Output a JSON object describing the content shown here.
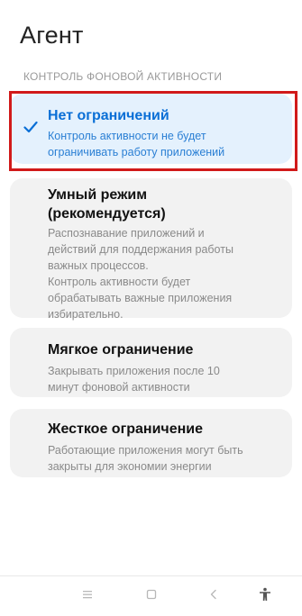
{
  "header": {
    "title": "Агент"
  },
  "section": {
    "label": "КОНТРОЛЬ ФОНОВОЙ АКТИВНОСТИ"
  },
  "options": [
    {
      "title": "Нет ограничений",
      "desc_lines": [
        "Контроль активности не будет",
        "ограничивать работу приложений"
      ],
      "selected": true
    },
    {
      "title_lines": [
        "Умный режим",
        "(рекомендуется)"
      ],
      "desc_lines": [
        "Распознавание приложений и",
        "действий для поддержания работы",
        "важных процессов.",
        "Контроль активности будет",
        "обрабатывать важные приложения",
        "избирательно."
      ],
      "selected": false
    },
    {
      "title": "Мягкое ограничение",
      "desc_lines": [
        "Закрывать приложения после 10",
        "минут фоновой активности"
      ],
      "selected": false
    },
    {
      "title": "Жесткое ограничение",
      "desc_lines": [
        "Работающие приложения могут быть",
        "закрыты для экономии энергии"
      ],
      "selected": false
    }
  ],
  "navbar": {
    "icons": [
      "menu-icon",
      "home-icon",
      "back-icon",
      "accessibility-icon"
    ]
  },
  "colors": {
    "selected_bg": "#e4f1fd",
    "selected_text": "#0a6fd6",
    "card_bg": "#f2f2f2",
    "highlight_border": "#d11a1a"
  }
}
